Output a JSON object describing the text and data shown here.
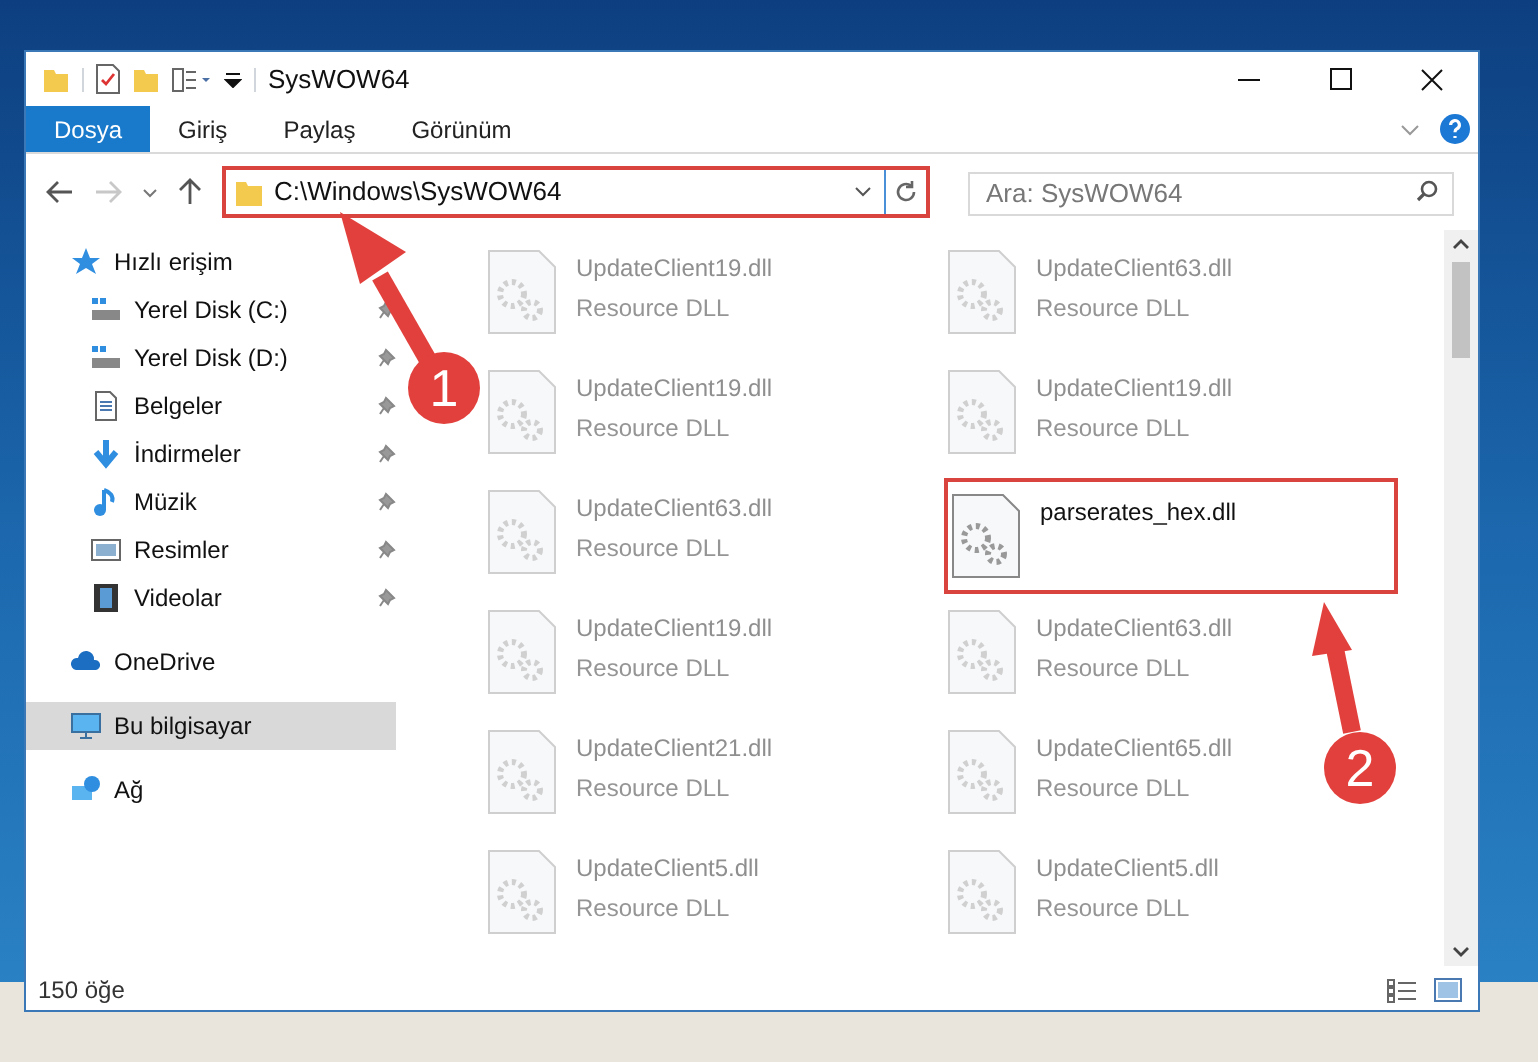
{
  "window": {
    "title": "SysWOW64"
  },
  "ribbon_tabs": [
    {
      "label": "Dosya",
      "selected": true
    },
    {
      "label": "Giriş",
      "selected": false
    },
    {
      "label": "Paylaş",
      "selected": false
    },
    {
      "label": "Görünüm",
      "selected": false
    }
  ],
  "address_bar": {
    "path": "C:\\Windows\\SysWOW64"
  },
  "search": {
    "placeholder": "Ara: SysWOW64"
  },
  "sidebar": {
    "items": [
      {
        "label": "Hızlı erişim",
        "kind": "star",
        "pinned": false,
        "selected": false,
        "children": [
          {
            "label": "Yerel Disk (C:)",
            "kind": "drive",
            "pinned": true,
            "selected": false
          },
          {
            "label": "Yerel Disk (D:)",
            "kind": "drive",
            "pinned": true,
            "selected": false
          },
          {
            "label": "Belgeler",
            "kind": "document",
            "pinned": true,
            "selected": false
          },
          {
            "label": "İndirmeler",
            "kind": "download",
            "pinned": true,
            "selected": false
          },
          {
            "label": "Müzik",
            "kind": "music",
            "pinned": true,
            "selected": false
          },
          {
            "label": "Resimler",
            "kind": "picture",
            "pinned": true,
            "selected": false
          },
          {
            "label": "Videolar",
            "kind": "video",
            "pinned": true,
            "selected": false
          }
        ]
      },
      {
        "label": "OneDrive",
        "kind": "cloud",
        "pinned": false,
        "selected": false
      },
      {
        "label": "Bu bilgisayar",
        "kind": "computer",
        "pinned": false,
        "selected": true
      },
      {
        "label": "Ağ",
        "kind": "network",
        "pinned": false,
        "selected": false
      }
    ]
  },
  "files": [
    {
      "name": "UpdateClient19.dll",
      "type": "Resource DLL",
      "dimmed": true
    },
    {
      "name": "UpdateClient63.dll",
      "type": "Resource DLL",
      "dimmed": true
    },
    {
      "name": "UpdateClient19.dll",
      "type": "Resource DLL",
      "dimmed": true
    },
    {
      "name": "UpdateClient19.dll",
      "type": "Resource DLL",
      "dimmed": true
    },
    {
      "name": "UpdateClient63.dll",
      "type": "Resource DLL",
      "dimmed": true
    },
    {
      "name": "parserates_hex.dll",
      "dimmed": false
    },
    {
      "name": "UpdateClient19.dll",
      "type": "Resource DLL",
      "dimmed": true
    },
    {
      "name": "UpdateClient63.dll",
      "type": "Resource DLL",
      "dimmed": true
    },
    {
      "name": "UpdateClient21.dll",
      "type": "Resource DLL",
      "dimmed": true
    },
    {
      "name": "UpdateClient65.dll",
      "type": "Resource DLL",
      "dimmed": true
    },
    {
      "name": "UpdateClient5.dll",
      "type": "Resource DLL",
      "dimmed": true
    },
    {
      "name": "UpdateClient5.dll",
      "type": "Resource DLL",
      "dimmed": true
    }
  ],
  "status_bar": {
    "count": "150 öğe"
  },
  "annotations": [
    {
      "number": "1"
    },
    {
      "number": "2"
    }
  ]
}
